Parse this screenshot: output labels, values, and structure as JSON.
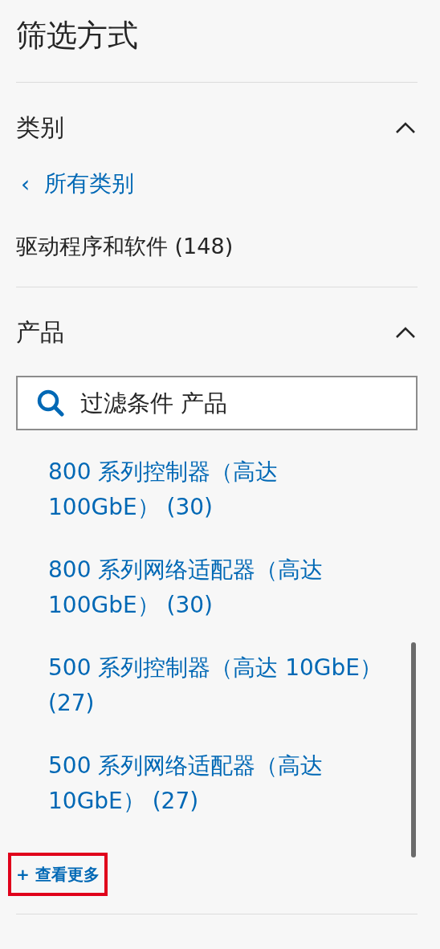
{
  "title": "筛选方式",
  "sections": [
    {
      "kind": "category",
      "heading": "类别",
      "expanded": true,
      "back_link": {
        "icon": "‹",
        "label": "所有类别"
      },
      "current": "驱动程序和软件 (148)"
    },
    {
      "kind": "product",
      "heading": "产品",
      "expanded": true,
      "search": {
        "placeholder": "过滤条件 产品"
      },
      "items": [
        {
          "label": "800 系列控制器（高达 100GbE） (30)"
        },
        {
          "label": "800 系列网络适配器（高达 100GbE） (30)"
        },
        {
          "label": "500 系列控制器（高达 10GbE） (27)"
        },
        {
          "label": "500 系列网络适配器（高达 10GbE） (27)"
        }
      ],
      "see_more": {
        "label": "+ 查看更多",
        "highlighted": true
      }
    }
  ]
}
